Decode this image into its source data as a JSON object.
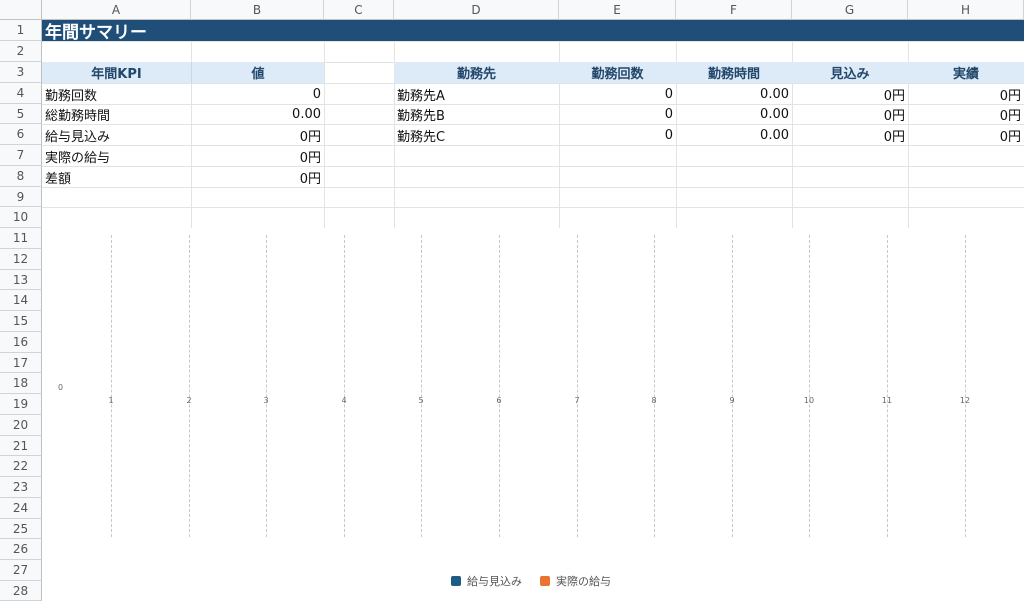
{
  "columns": [
    "A",
    "B",
    "C",
    "D",
    "E",
    "F",
    "G",
    "H"
  ],
  "rows": [
    "1",
    "2",
    "3",
    "4",
    "5",
    "6",
    "7",
    "8",
    "9",
    "10",
    "11",
    "12",
    "13",
    "14",
    "15",
    "16",
    "17",
    "18",
    "19",
    "20",
    "21",
    "22",
    "23",
    "24",
    "25",
    "26",
    "27",
    "28"
  ],
  "title": "年間サマリー",
  "kpi": {
    "header_label": "年間KPI",
    "header_value": "値",
    "items": [
      {
        "label": "勤務回数",
        "value": "0"
      },
      {
        "label": "総勤務時間",
        "value": "0.00"
      },
      {
        "label": "給与見込み",
        "value": "0円"
      },
      {
        "label": "実際の給与",
        "value": "0円"
      },
      {
        "label": "差額",
        "value": "0円"
      }
    ]
  },
  "workplaces": {
    "headers": [
      "勤務先",
      "勤務回数",
      "勤務時間",
      "見込み",
      "実績"
    ],
    "rows": [
      [
        "勤務先A",
        "0",
        "0.00",
        "0円",
        "0円"
      ],
      [
        "勤務先B",
        "0",
        "0.00",
        "0円",
        "0円"
      ],
      [
        "勤務先C",
        "0",
        "0.00",
        "0円",
        "0円"
      ]
    ]
  },
  "chart_data": {
    "type": "bar",
    "categories": [
      "1",
      "2",
      "3",
      "4",
      "5",
      "6",
      "7",
      "8",
      "9",
      "10",
      "11",
      "12"
    ],
    "y_tick_labels": [
      "0"
    ],
    "series": [
      {
        "name": "給与見込み",
        "color": "#1f5c85",
        "values": [
          0,
          0,
          0,
          0,
          0,
          0,
          0,
          0,
          0,
          0,
          0,
          0
        ]
      },
      {
        "name": "実際の給与",
        "color": "#e8742f",
        "values": [
          0,
          0,
          0,
          0,
          0,
          0,
          0,
          0,
          0,
          0,
          0,
          0
        ]
      }
    ],
    "legend": "bottom-center",
    "grid": "vertical-dashed"
  }
}
